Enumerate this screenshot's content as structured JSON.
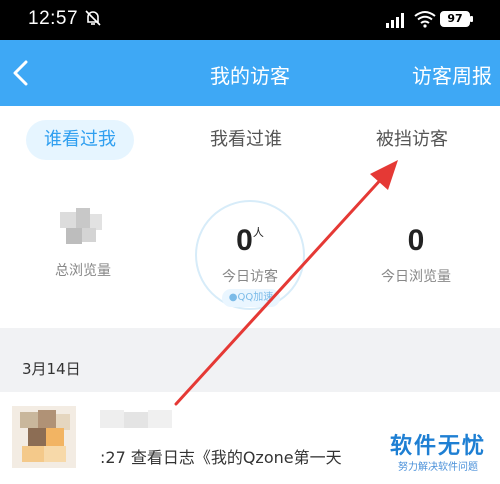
{
  "status_bar": {
    "time": "12:57",
    "battery": "97"
  },
  "nav": {
    "title": "我的访客",
    "right_label": "访客周报"
  },
  "tabs": [
    {
      "label": "谁看过我",
      "active": true
    },
    {
      "label": "我看过谁",
      "active": false
    },
    {
      "label": "被挡访客",
      "active": false
    }
  ],
  "stats": {
    "total_label": "总浏览量",
    "today_visitors_value": "0",
    "today_visitors_unit": "人",
    "today_visitors_label": "今日访客",
    "qq_badge": "QQ加速",
    "today_views_value": "0",
    "today_views_label": "今日浏览量"
  },
  "list": {
    "date": "3月14日",
    "activity": ":27 查看日志《我的Qzone第一天"
  },
  "watermark": {
    "main": "软件无忧",
    "sub": "努力解决软件问题"
  },
  "colors": {
    "accent": "#3ea8f5",
    "arrow": "#e53935"
  }
}
